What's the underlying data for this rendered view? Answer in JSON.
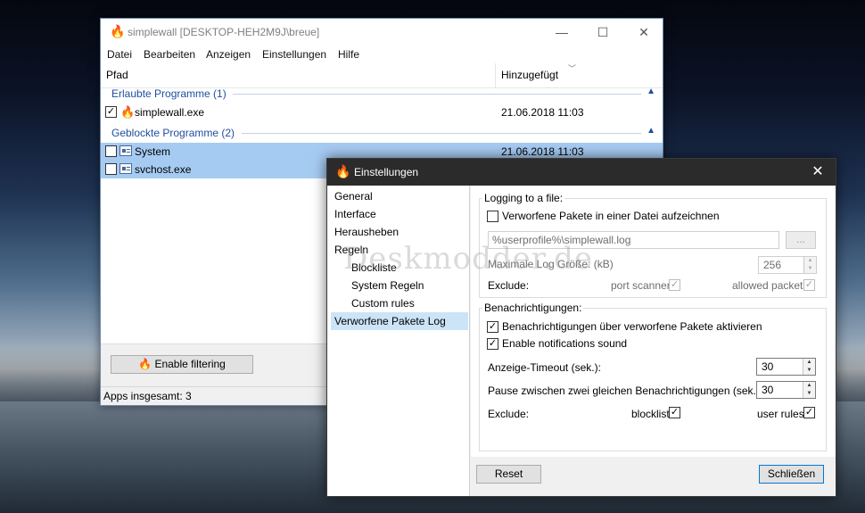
{
  "main_window": {
    "title": "simplewall [DESKTOP-HEH2M9J\\breue]",
    "app_icon": "flame-icon",
    "window_buttons": [
      "—",
      "☐",
      "✕"
    ],
    "menu": [
      "Datei",
      "Bearbeiten",
      "Anzeigen",
      "Einstellungen",
      "Hilfe"
    ],
    "columns": [
      "Pfad",
      "Hinzugefügt"
    ],
    "groups": [
      {
        "name": "Erlaubte Programme (1)",
        "items": [
          {
            "checked": true,
            "icon": "flame-icon",
            "name": "simplewall.exe",
            "date": "21.06.2018 11:03"
          }
        ]
      },
      {
        "name": "Geblockte Programme (2)",
        "items": [
          {
            "checked": false,
            "icon": "system-window-icon",
            "name": "System",
            "date": "21.06.2018 11:03"
          },
          {
            "checked": false,
            "icon": "system-window-icon",
            "name": "svchost.exe",
            "date": ""
          }
        ]
      }
    ],
    "enable_filtering_label": "Enable filtering",
    "status": "Apps insgesamt: 3"
  },
  "settings_window": {
    "title": "Einstellungen",
    "nav": [
      {
        "label": "General",
        "indent": false,
        "selected": false
      },
      {
        "label": "Interface",
        "indent": false,
        "selected": false
      },
      {
        "label": "Herausheben",
        "indent": false,
        "selected": false
      },
      {
        "label": "Regeln",
        "indent": false,
        "selected": false
      },
      {
        "label": "Blockliste",
        "indent": true,
        "selected": false
      },
      {
        "label": "System Regeln",
        "indent": true,
        "selected": false
      },
      {
        "label": "Custom rules",
        "indent": true,
        "selected": false
      },
      {
        "label": "Verworfene Pakete Log",
        "indent": false,
        "selected": true
      }
    ],
    "logging": {
      "group_label": "Logging to a file:",
      "enable_label": "Verworfene Pakete in einer Datei aufzeichnen",
      "enabled": false,
      "path_value": "%userprofile%\\simplewall.log",
      "browse_label": "...",
      "max_size_label": "Maximale Log Größe: (kB)",
      "max_size_value": "256",
      "exclude_label": "Exclude:",
      "port_scanner_label": "port scanner",
      "allowed_packets_label": "allowed packets"
    },
    "notifications": {
      "group_label": "Benachrichtigungen:",
      "enable_label": "Benachrichtigungen über verworfene Pakete aktivieren",
      "sound_label": "Enable notifications sound",
      "timeout_label": "Anzeige-Timeout (sek.):",
      "timeout_value": "30",
      "pause_label": "Pause zwischen zwei gleichen Benachrichtigungen (sek.):",
      "pause_value": "30",
      "exclude_label": "Exclude:",
      "blocklist_label": "blocklist",
      "user_rules_label": "user rules"
    },
    "reset_label": "Reset",
    "close_label": "Schließen"
  },
  "watermark": "Deskmodder.de"
}
